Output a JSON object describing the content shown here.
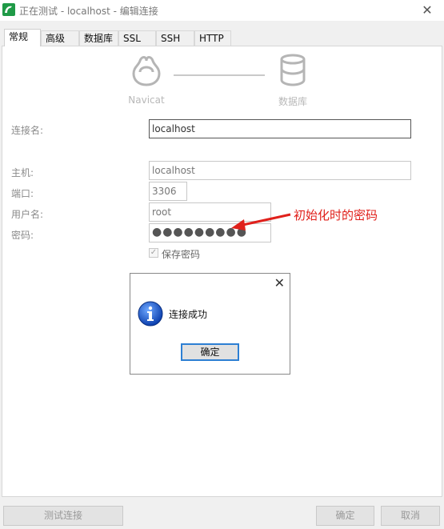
{
  "window": {
    "title": "正在测试 - localhost - 编辑连接",
    "close_glyph": "✕",
    "icon": "navicat-app-icon"
  },
  "tabs": [
    "常规",
    "高级",
    "数据库",
    "SSL",
    "SSH",
    "HTTP"
  ],
  "header": {
    "left_label": "Navicat",
    "right_label": "数据库"
  },
  "form": {
    "connection_name": {
      "label": "连接名:",
      "value": "localhost"
    },
    "host": {
      "label": "主机:",
      "value": "localhost"
    },
    "port": {
      "label": "端口:",
      "value": "3306"
    },
    "username": {
      "label": "用户名:",
      "value": "root"
    },
    "password": {
      "label": "密码:",
      "value": "●●●●●●●●●"
    },
    "save_password": {
      "label": "保存密码",
      "checked": true
    }
  },
  "annotation": {
    "text": "初始化时的密码",
    "color": "#e0201b"
  },
  "dialog": {
    "close_glyph": "✕",
    "message": "连接成功",
    "ok_label": "确定",
    "icon": "info-icon"
  },
  "buttons": {
    "test": "测试连接",
    "ok": "确定",
    "cancel": "取消"
  }
}
